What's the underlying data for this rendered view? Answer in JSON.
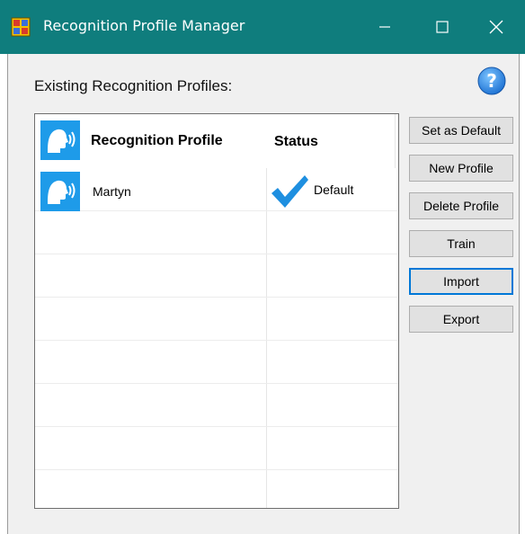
{
  "window": {
    "title": "Recognition Profile Manager",
    "titlebar_color": "#0f7d7d"
  },
  "main": {
    "heading": "Existing Recognition Profiles:",
    "help_icon": "help-question-icon"
  },
  "list": {
    "columns": [
      "Recognition Profile",
      "Status"
    ],
    "rows": [
      {
        "profile": "Martyn",
        "status": "Default",
        "icon": "speaking-head-icon",
        "status_icon": "checkmark-icon"
      }
    ],
    "empty_rows": 6
  },
  "buttons": {
    "set_default": "Set as Default",
    "new_profile": "New Profile",
    "delete_profile": "Delete Profile",
    "train": "Train",
    "import": "Import",
    "export": "Export"
  },
  "colors": {
    "accent": "#0078d7",
    "icon_blue": "#1e9be9"
  }
}
